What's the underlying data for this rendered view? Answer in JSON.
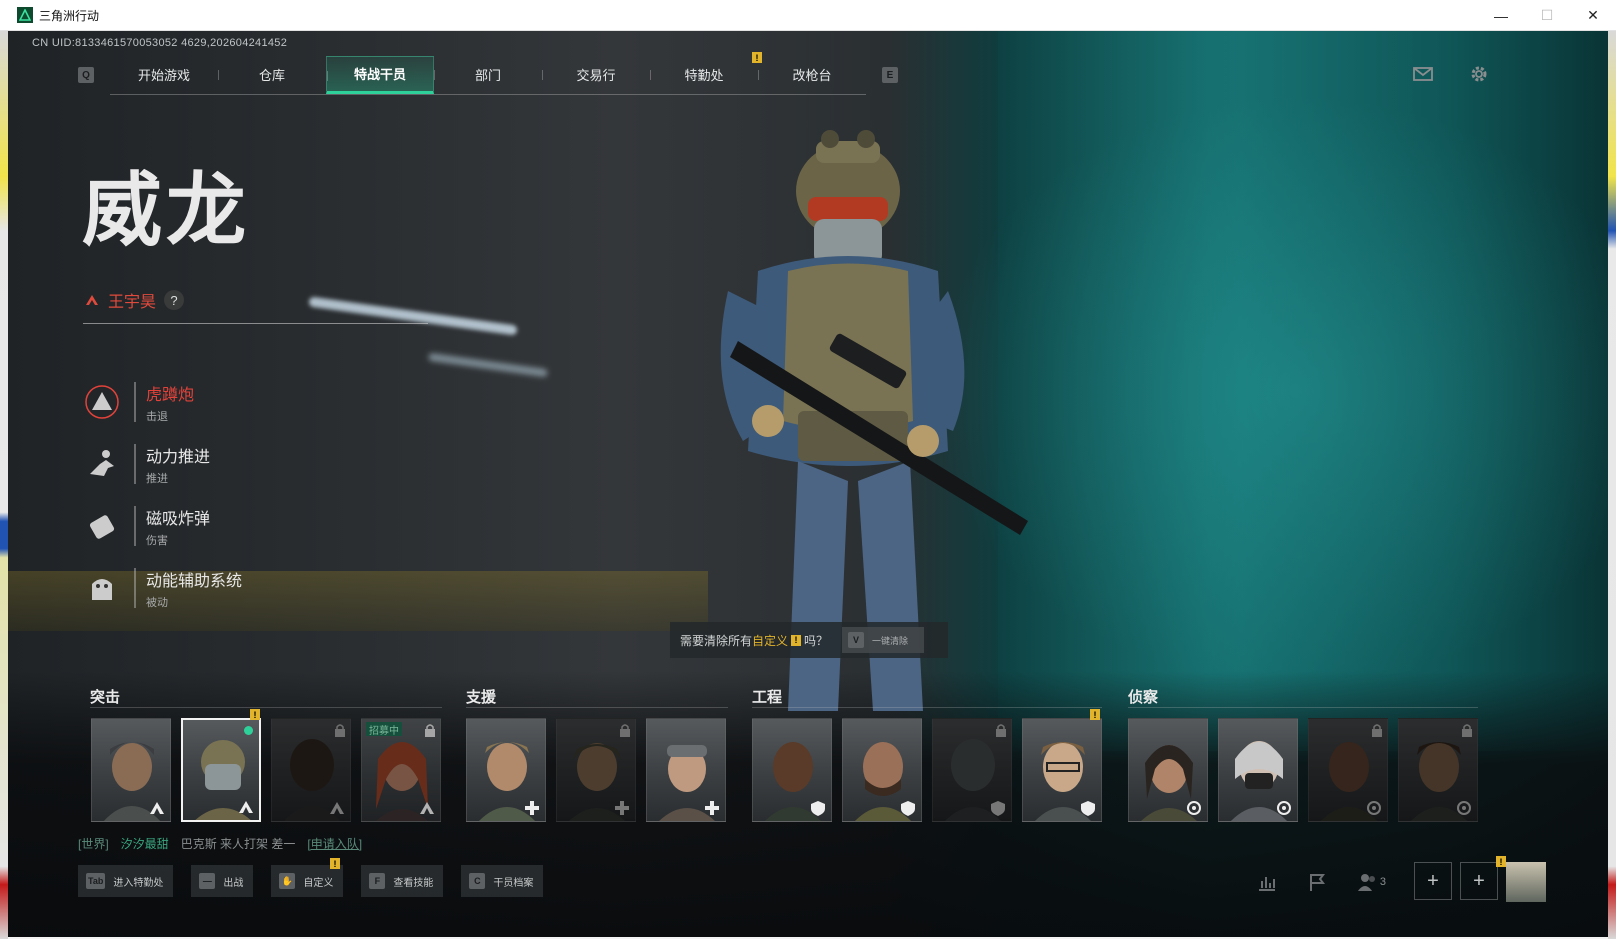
{
  "window": {
    "title": "三角洲行动",
    "controls": [
      "—",
      "☐",
      "✕"
    ]
  },
  "uid": "CN UID:8133461570053052 4629,202604241452",
  "nav": {
    "left_key": "Q",
    "right_key": "E",
    "tabs": [
      "开始游戏",
      "仓库",
      "特战干员",
      "部门",
      "交易行",
      "特勤处",
      "改枪台"
    ],
    "active_tab": "特战干员",
    "badge": "!"
  },
  "operator": {
    "name": "威龙",
    "player_name": "王宇昊",
    "help": "?",
    "skills": [
      {
        "name": "虎蹲炮",
        "type": "击退",
        "icon": "mortar-icon",
        "highlight": true
      },
      {
        "name": "动力推进",
        "type": "推进",
        "icon": "dash-icon",
        "highlight": false
      },
      {
        "name": "磁吸炸弹",
        "type": "伤害",
        "icon": "bomb-icon",
        "highlight": false
      },
      {
        "name": "动能辅助系统",
        "type": "被动",
        "icon": "exo-icon",
        "highlight": false
      }
    ]
  },
  "prompt": {
    "text_pre": "需要清除所有",
    "text_accent": "自定义",
    "badge": "!",
    "text_post": "吗？",
    "key": "V",
    "button": "一键清除"
  },
  "classes": [
    {
      "label": "突击",
      "role_icon": "assault-icon"
    },
    {
      "label": "支援",
      "role_icon": "support-icon"
    },
    {
      "label": "工程",
      "role_icon": "engineer-icon"
    },
    {
      "label": "侦察",
      "role_icon": "recon-icon"
    }
  ],
  "recruit_label": "招募中",
  "chat": {
    "channel": "[世界]",
    "sender": "汐汐最甜",
    "message": "巴克斯 来人打架 差一",
    "link": "[申请入队]"
  },
  "actions": [
    {
      "key": "Tab",
      "label": "进入特勤处"
    },
    {
      "key": "—",
      "label": "出战"
    },
    {
      "key": "✋",
      "label": "自定义"
    },
    {
      "key": "F",
      "label": "查看技能"
    },
    {
      "key": "C",
      "label": "干员档案"
    }
  ],
  "bottom_right": {
    "squad_count": "3",
    "add_slot": "+"
  },
  "colors": {
    "accent_green": "#2fd19a",
    "highlight_red": "#e2423a",
    "warn_yellow": "#e2b42b"
  }
}
